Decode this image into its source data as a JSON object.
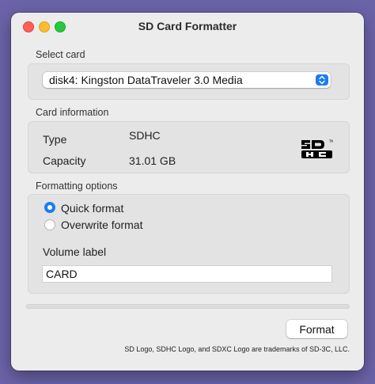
{
  "window": {
    "title": "SD Card Formatter"
  },
  "select_card": {
    "label": "Select card",
    "selected": "disk4: Kingston DataTraveler 3.0 Media"
  },
  "card_info": {
    "label": "Card information",
    "type_key": "Type",
    "type_value": "SDHC",
    "capacity_key": "Capacity",
    "capacity_value": "31.01 GB",
    "logo_icon": "sdhc-logo-icon"
  },
  "formatting": {
    "label": "Formatting options",
    "options": [
      {
        "label": "Quick format",
        "selected": true
      },
      {
        "label": "Overwrite format",
        "selected": false
      }
    ],
    "volume_label_title": "Volume label",
    "volume_label_value": "CARD"
  },
  "progress": {
    "value": 0
  },
  "actions": {
    "format_label": "Format"
  },
  "footer": {
    "trademark": "SD Logo, SDHC Logo, and SDXC Logo are trademarks of SD-3C, LLC."
  },
  "colors": {
    "accent": "#1a7cf3",
    "close": "#fe5f57",
    "minimize": "#febc2e",
    "zoom": "#28c840",
    "desktop": "#6b63a8"
  }
}
